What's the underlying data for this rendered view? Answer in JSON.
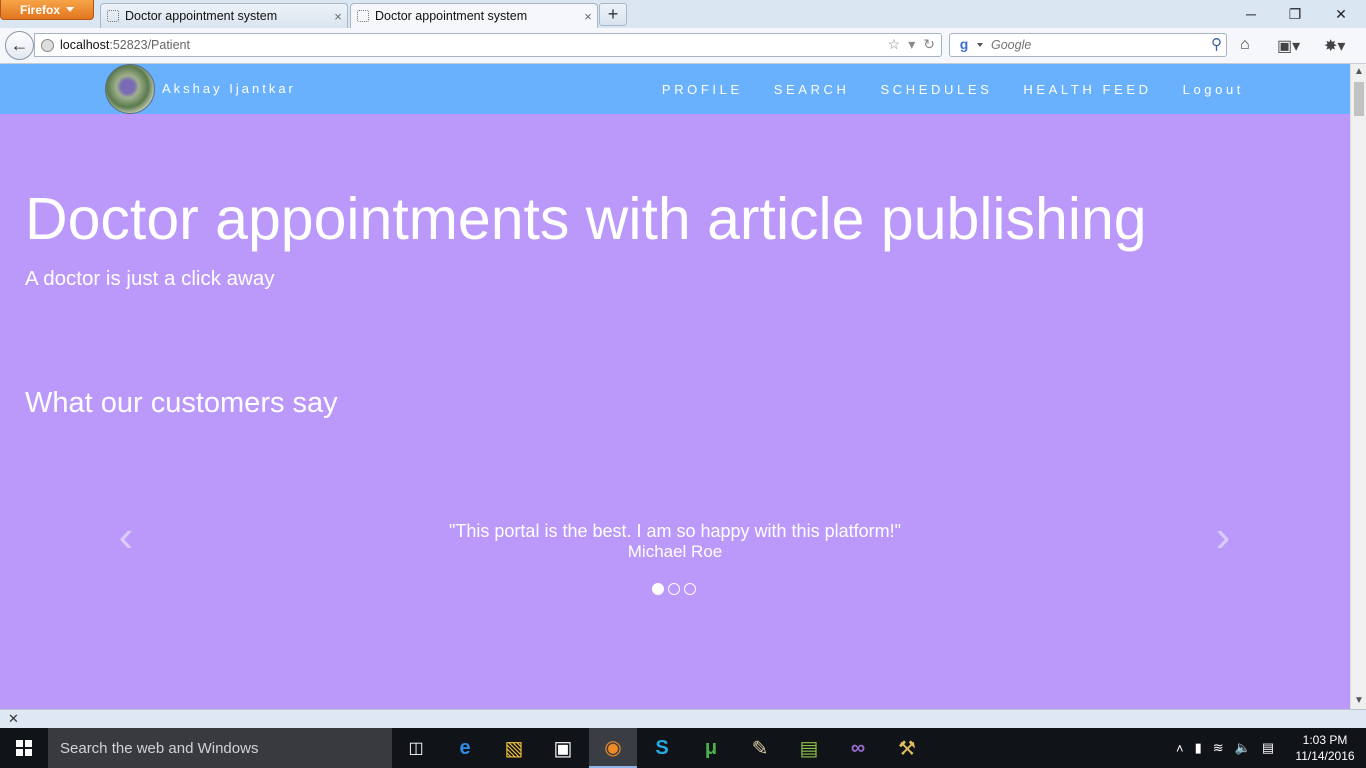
{
  "browser": {
    "menu_button": "Firefox",
    "tabs": [
      {
        "title": "Doctor appointment system",
        "close": "×"
      },
      {
        "title": "Doctor appointment system",
        "close": "×"
      }
    ],
    "new_tab": "+",
    "window_controls": {
      "minimize": "─",
      "restore": "❐",
      "close": "✕"
    },
    "url_host": "localhost",
    "url_rest": ":52823/Patient",
    "search_engine_logo": "g",
    "search_placeholder": "Google",
    "addon_bar_close": "✕"
  },
  "site": {
    "user_name": "Akshay Ijantkar",
    "nav": [
      "PROFILE",
      "SEARCH",
      "SCHEDULES",
      "HEALTH FEED",
      "Logout"
    ],
    "hero_title": "Doctor appointments with article publishing",
    "hero_subtitle": "A doctor is just a click away",
    "testimonials_title": "What our customers say",
    "carousel": {
      "quote": "\"This portal is the best. I am so happy with this platform!\"",
      "author": "Michael Roe",
      "active_index": 0,
      "slides": 3,
      "prev": "‹",
      "next": "›"
    }
  },
  "taskbar": {
    "search_placeholder": "Search the web and Windows",
    "time": "1:03 PM",
    "date": "11/14/2016"
  },
  "colors": {
    "header": "#69b1fc",
    "page_background": "#bb99fb",
    "text": "#ffffff"
  }
}
